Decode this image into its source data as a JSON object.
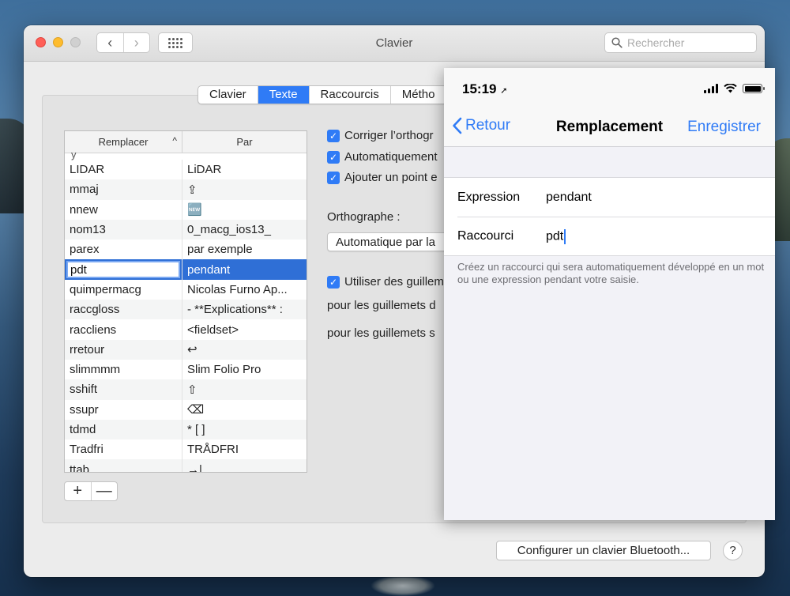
{
  "window": {
    "title": "Clavier",
    "search_placeholder": "Rechercher",
    "nav_back": "‹",
    "nav_forward": "›"
  },
  "tabs": [
    {
      "label": "Clavier",
      "active": false
    },
    {
      "label": "Texte",
      "active": true
    },
    {
      "label": "Raccourcis",
      "active": false
    },
    {
      "label": "Métho",
      "active": false
    }
  ],
  "table": {
    "col_replace": "Remplacer",
    "col_with": "Par",
    "sort_indicator": "^",
    "cut_top_glyph": "y",
    "rows": [
      {
        "replace": "LIDAR",
        "with": "LiDAR"
      },
      {
        "replace": "mmaj",
        "with": "⇪"
      },
      {
        "replace": "nnew",
        "with": "🆕"
      },
      {
        "replace": "nom13",
        "with": "0_macg_ios13_"
      },
      {
        "replace": "parex",
        "with": "par exemple"
      },
      {
        "replace": "pdt",
        "with": "pendant",
        "selected": true
      },
      {
        "replace": "quimpermacg",
        "with": "Nicolas Furno Ap..."
      },
      {
        "replace": "raccgloss",
        "with": "- **Explications** :"
      },
      {
        "replace": "raccliens",
        "with": "<fieldset>"
      },
      {
        "replace": "rretour",
        "with": "↩"
      },
      {
        "replace": "slimmmm",
        "with": "Slim Folio Pro"
      },
      {
        "replace": "sshift",
        "with": "⇧"
      },
      {
        "replace": "ssupr",
        "with": "⌫"
      },
      {
        "replace": "tdmd",
        "with": "* [ ]"
      },
      {
        "replace": "Tradfri",
        "with": "TRÅDFRI"
      },
      {
        "replace": "ttab",
        "with": "→|"
      }
    ],
    "add_label": "+",
    "remove_label": "—"
  },
  "options": {
    "check1": "Corriger l’orthogr",
    "check2": "Automatiquement",
    "check3": "Ajouter un point e",
    "spelling_label": "Orthographe :",
    "spelling_value": "Automatique par la",
    "check4": "Utiliser des guillem",
    "double_quotes_label": "pour les guillemets d",
    "single_quotes_label": "pour les guillemets s",
    "check_glyph": "✓"
  },
  "bottom": {
    "bluetooth_button": "Configurer un clavier Bluetooth...",
    "help_button": "?"
  },
  "phone": {
    "time": "15:19",
    "location_glyph": "➚",
    "back_label": "Retour",
    "nav_title": "Remplacement",
    "save_label": "Enregistrer",
    "expression_label": "Expression",
    "expression_value": "pendant",
    "shortcut_label": "Raccourci",
    "shortcut_value": "pdt",
    "footnote": "Créez un raccourci qui sera automatiquement développé en un mot ou une expression pendant votre saisie."
  },
  "colors": {
    "accent": "#2f7bf6",
    "selection": "#2f6fd6"
  }
}
